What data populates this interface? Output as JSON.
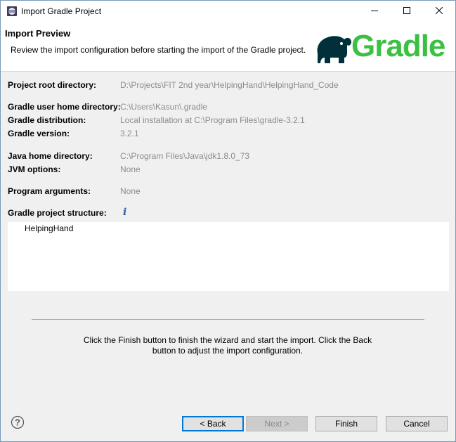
{
  "window": {
    "title": "Import Gradle Project",
    "icon": "eclipse-icon",
    "controls": [
      "minimize-icon",
      "maximize-icon",
      "close-icon"
    ]
  },
  "header": {
    "title": "Import Preview",
    "description": "Review the import configuration before starting the import of the Gradle project.",
    "logo_text": "Gradle",
    "logo_color": "#3cc043"
  },
  "config": {
    "project_root": {
      "label": "Project root directory:",
      "value": "D:\\Projects\\FIT 2nd year\\HelpingHand\\HelpingHand_Code"
    },
    "user_home": {
      "label": "Gradle user home directory:",
      "value": "C:\\Users\\Kasun\\.gradle"
    },
    "distribution": {
      "label": "Gradle distribution:",
      "value": "Local installation at C:\\Program Files\\gradle-3.2.1"
    },
    "version": {
      "label": "Gradle version:",
      "value": "3.2.1"
    },
    "java_home": {
      "label": "Java home directory:",
      "value": "C:\\Program Files\\Java\\jdk1.8.0_73"
    },
    "jvm_options": {
      "label": "JVM options:",
      "value": "None"
    },
    "program_args": {
      "label": "Program arguments:",
      "value": "None"
    },
    "structure": {
      "label": "Gradle project structure:",
      "info_icon": "info-icon"
    }
  },
  "tree": {
    "items": [
      "HelpingHand"
    ]
  },
  "message": "Click the Finish button to finish the wizard and start the import. Click the Back button to adjust the import configuration.",
  "buttons": {
    "help_icon": "help-icon",
    "back": "< Back",
    "next": "Next >",
    "finish": "Finish",
    "cancel": "Cancel"
  }
}
